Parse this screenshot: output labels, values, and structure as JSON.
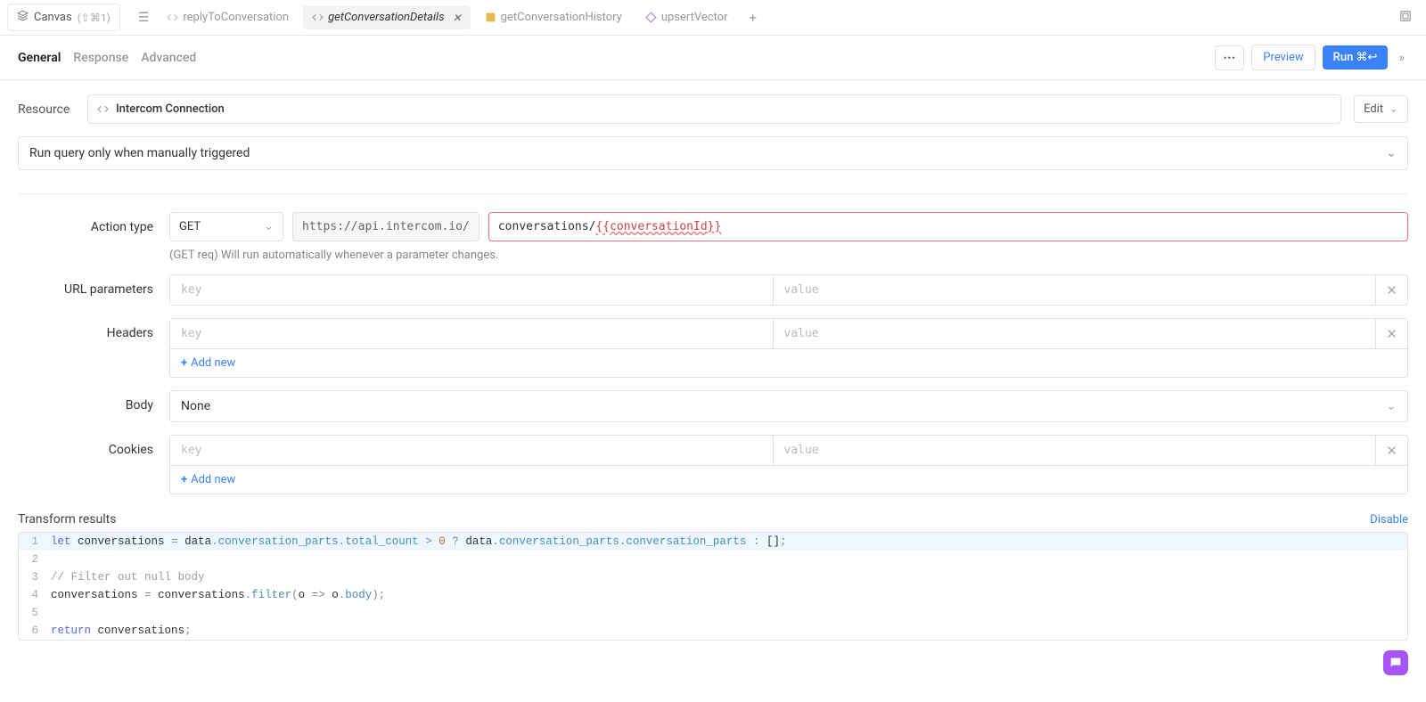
{
  "topbar": {
    "canvas_label": "Canvas",
    "canvas_shortcut": "(⇧⌘1)",
    "tabs": [
      {
        "label": "replyToConversation",
        "active": false,
        "icon": "code",
        "color": "#bbb"
      },
      {
        "label": "getConversationDetails",
        "active": true,
        "icon": "code",
        "color": "#bbb",
        "closable": true
      },
      {
        "label": "getConversationHistory",
        "active": false,
        "icon": "js",
        "color": "#e8b64a"
      },
      {
        "label": "upsertVector",
        "active": false,
        "icon": "diamond",
        "color": "#b084dc"
      }
    ]
  },
  "subtabs": {
    "items": [
      "General",
      "Response",
      "Advanced"
    ],
    "active": "General"
  },
  "buttons": {
    "preview": "Preview",
    "run": "Run ⌘↩",
    "more": "⋯",
    "edit": "Edit"
  },
  "resource": {
    "label": "Resource",
    "name": "Intercom Connection"
  },
  "trigger": {
    "text": "Run query only when manually triggered"
  },
  "action": {
    "label": "Action type",
    "method": "GET",
    "base_url": "https://api.intercom.io/",
    "path_prefix": "conversations/",
    "path_template": "{{conversationId}}",
    "hint": "(GET req) Will run automatically whenever a parameter changes."
  },
  "url_params": {
    "label": "URL parameters",
    "key_placeholder": "key",
    "value_placeholder": "value"
  },
  "headers": {
    "label": "Headers",
    "key_placeholder": "key",
    "value_placeholder": "value",
    "add_new": "Add new"
  },
  "body_field": {
    "label": "Body",
    "value": "None"
  },
  "cookies": {
    "label": "Cookies",
    "key_placeholder": "key",
    "value_placeholder": "value",
    "add_new": "Add new"
  },
  "transform": {
    "title": "Transform results",
    "disable": "Disable",
    "code_lines": [
      "let conversations = data.conversation_parts.total_count > 0 ? data.conversation_parts.conversation_parts : [];",
      "",
      "// Filter out null body",
      "conversations = conversations.filter(o => o.body);",
      "",
      "return conversations;"
    ]
  }
}
